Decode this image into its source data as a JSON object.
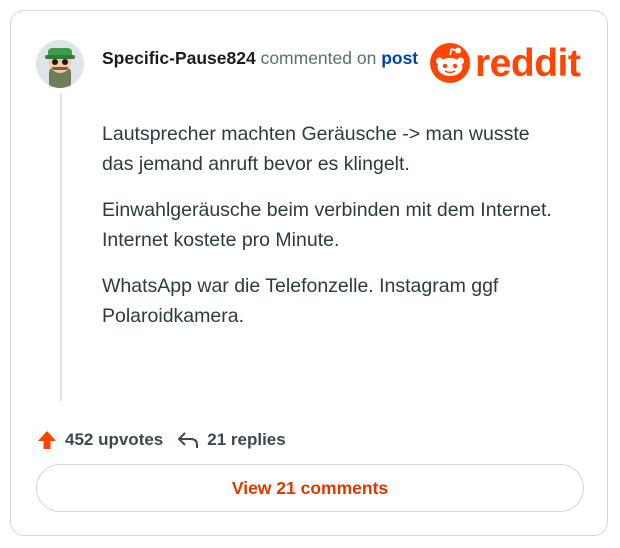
{
  "comment": {
    "username": "Specific-Pause824",
    "action_text": " commented on ",
    "post_link": "post",
    "paragraphs": [
      "Lautsprecher machten Geräusche -> man wusste das jemand anruft bevor es klingelt.",
      "Einwahlgeräusche beim verbinden mit dem Internet. Internet kostete pro Minute.",
      "WhatsApp war die Telefonzelle. Instagram ggf Polaroidkamera."
    ]
  },
  "brand": {
    "wordmark": "reddit",
    "color": "#ff4500",
    "icon": "reddit-snoo-icon"
  },
  "stats": {
    "upvotes": "452 upvotes",
    "replies": "21 replies",
    "upvote_icon": "upvote-arrow-icon",
    "reply_icon": "reply-arrow-icon",
    "upvote_color": "#ff4500"
  },
  "actions": {
    "view_comments": "View 21 comments",
    "color": "#d93a00"
  }
}
